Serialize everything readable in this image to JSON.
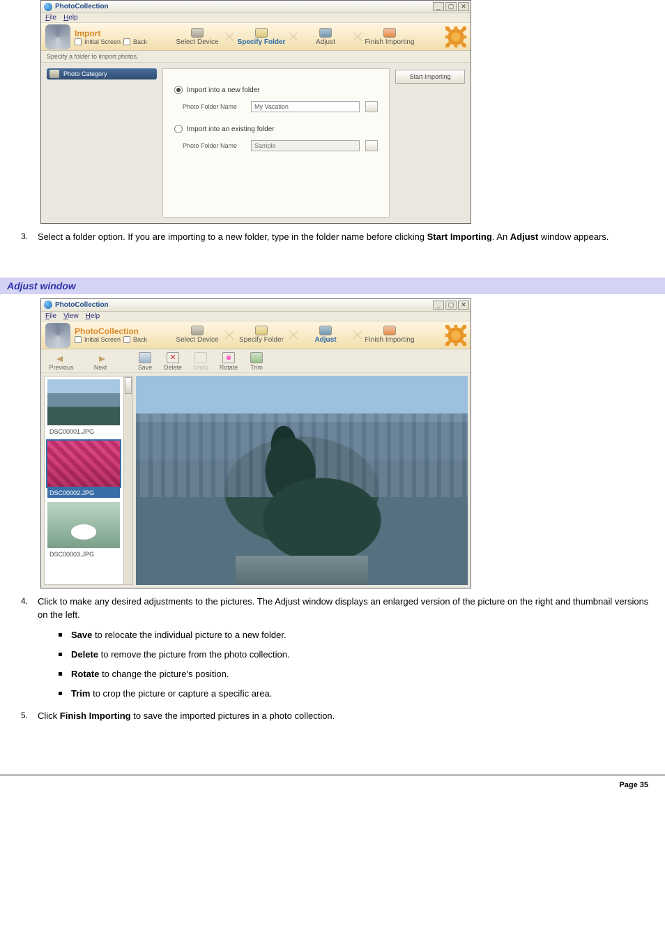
{
  "step3": {
    "pre": "Select a folder option. If you are importing to a new folder, type in the folder name before clicking ",
    "bold1": "Start Importing",
    "mid": ". An ",
    "bold2": "Adjust",
    "post": " window appears."
  },
  "heading_adjust": "Adjust window",
  "screenshot1": {
    "app_title": "PhotoCollection",
    "menu": {
      "file": "File",
      "help": "Help"
    },
    "wizard": {
      "title": "Import",
      "sub_initial": "Initial Screen",
      "sub_back": "Back",
      "steps": {
        "select_device": "Select Device",
        "specify_folder": "Specify Folder",
        "adjust": "Adjust",
        "finish": "Finish Importing"
      }
    },
    "hint": "Specify a folder to import photos.",
    "category_tab": "Photo Category",
    "opt_new": "Import into a new folder",
    "opt_existing": "Import into an existing folder",
    "field_label": "Photo Folder Name",
    "new_value": "My Vacation",
    "existing_placeholder": "Sample",
    "start_btn": "Start Importing",
    "win_btns": {
      "min": "_",
      "max": "▢",
      "close": "✕"
    }
  },
  "screenshot2": {
    "app_title": "PhotoCollection",
    "menu": {
      "file": "File",
      "view": "View",
      "help": "Help"
    },
    "wizard": {
      "title": "PhotoCollection",
      "sub_initial": "Initial Screen",
      "sub_back": "Back",
      "steps": {
        "select_device": "Select Device",
        "specify_folder": "Specify Folder",
        "adjust": "Adjust",
        "finish": "Finish Importing"
      }
    },
    "nav": {
      "prev": "Previous",
      "next": "Next"
    },
    "tools": {
      "save": "Save",
      "delete": "Delete",
      "undo": "Undo",
      "rotate": "Rotate",
      "trim": "Trim"
    },
    "thumbs": [
      {
        "name": "DSC00001.JPG"
      },
      {
        "name": "DSC00002.JPG"
      },
      {
        "name": "DSC00003.JPG"
      }
    ],
    "win_btns": {
      "min": "_",
      "max": "▢",
      "close": "✕"
    }
  },
  "step4": {
    "text": "Click to make any desired adjustments to the pictures. The Adjust window displays an enlarged version of the picture on the right and thumbnail versions on the left.",
    "bullets": [
      {
        "bold": "Save",
        "rest": " to relocate the individual picture to a new folder."
      },
      {
        "bold": "Delete",
        "rest": " to remove the picture from the photo collection."
      },
      {
        "bold": "Rotate",
        "rest": " to change the picture's position."
      },
      {
        "bold": "Trim",
        "rest": " to crop the picture or capture a specific area."
      }
    ]
  },
  "step5": {
    "pre": "Click ",
    "bold": "Finish Importing",
    "post": " to save the imported pictures in a photo collection."
  },
  "footer": "Page 35"
}
